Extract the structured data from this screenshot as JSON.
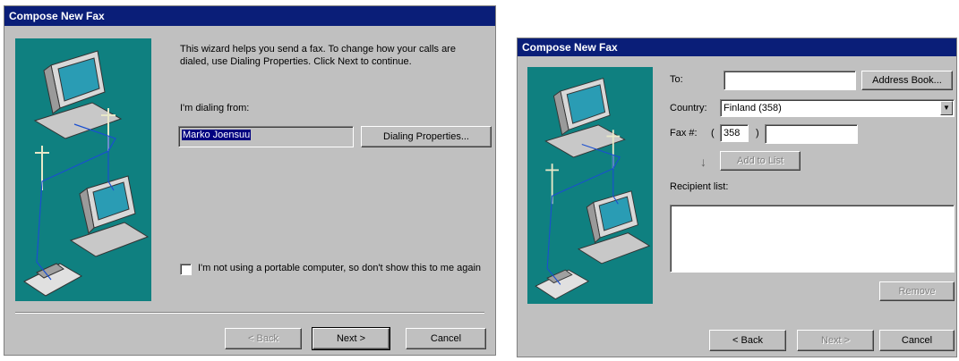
{
  "wizard1": {
    "title": "Compose New Fax",
    "intro": "This wizard helps you send a fax. To change how your calls are dialed, use Dialing Properties. Click Next to continue.",
    "dialing_from_label": "I'm dialing from:",
    "dialing_from_value": "Marko Joensuu",
    "dialing_properties_button": "Dialing Properties...",
    "checkbox_label": "I'm not using a portable computer, so don't show this to me again",
    "back_button": "< Back",
    "next_button": "Next >",
    "cancel_button": "Cancel"
  },
  "wizard2": {
    "title": "Compose New Fax",
    "to_label": "To:",
    "to_value": "",
    "address_book_button": "Address Book...",
    "country_label": "Country:",
    "country_value": "Finland (358)",
    "fax_label": "Fax #:",
    "fax_paren_open": "(",
    "fax_area_code": "358",
    "fax_paren_close": ")",
    "fax_number": "",
    "add_to_list_button": "Add to List",
    "recipient_list_label": "Recipient list:",
    "remove_button": "Remove",
    "back_button": "< Back",
    "next_button": "Next >",
    "cancel_button": "Cancel"
  },
  "colors": {
    "title_bar": "#0a1e78",
    "dialog_bg": "#c0c0c0",
    "art_bg": "#0f8080"
  },
  "icons": [
    "computer-icon",
    "fax-machine-icon",
    "telephone-pole-icon",
    "dropdown-arrow-icon",
    "down-arrow-icon"
  ]
}
